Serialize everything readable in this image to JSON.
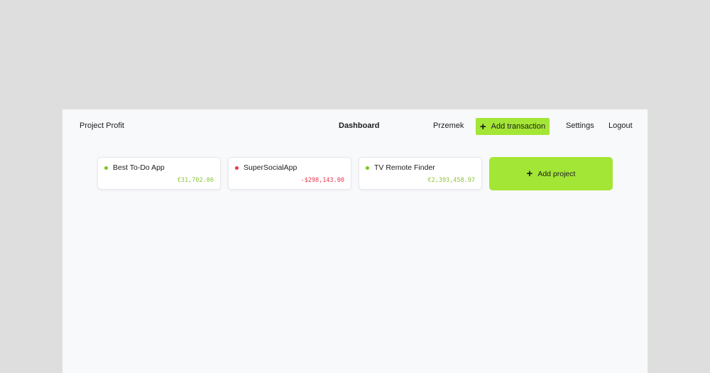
{
  "nav": {
    "brand": "Project Profit",
    "dashboard": "Dashboard",
    "user": "Przemek",
    "add_transaction": "Add transaction",
    "settings": "Settings",
    "logout": "Logout"
  },
  "projects": [
    {
      "name": "Best To-Do App",
      "amount": "€31,702.00",
      "status": "positive"
    },
    {
      "name": "SuperSocialApp",
      "amount": "-$298,143.00",
      "status": "negative"
    },
    {
      "name": "TV Remote Finder",
      "amount": "€2,393,458.97",
      "status": "positive"
    }
  ],
  "add_project": "Add project",
  "icons": {
    "add": "plus-icon",
    "status": "status-dot-icon"
  },
  "colors": {
    "accent": "#a4e636",
    "positive": "#7cc41e",
    "positive_text": "#8cc43a",
    "negative": "#e8384f",
    "negative_text": "#e8384f"
  }
}
